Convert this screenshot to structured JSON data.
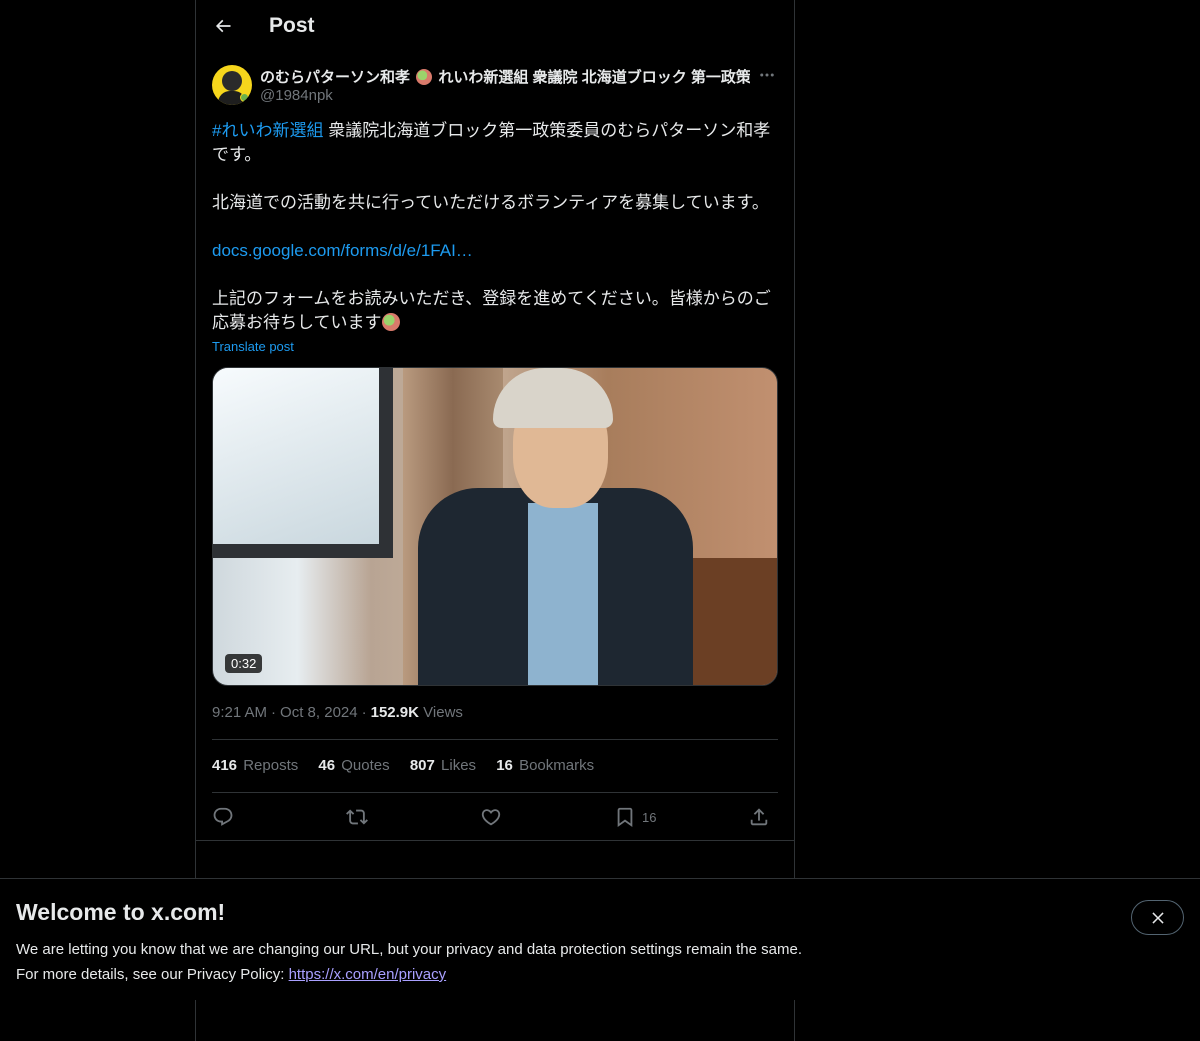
{
  "header": {
    "title": "Post",
    "back_icon": "arrow-left-icon"
  },
  "author": {
    "display_name_part1": "のむらパターソン和孝",
    "display_name_part2": "れいわ新選組 衆議院 北海道ブロック 第一政策委員",
    "handle": "@1984npk"
  },
  "tweet": {
    "hashtag": "#れいわ新選組",
    "line1_rest": " 衆議院北海道ブロック第一政策委員のむらパターソン和孝です。",
    "line2": "北海道での活動を共に行っていただけるボランティアを募集しています。",
    "link": "docs.google.com/forms/d/e/1FAI…",
    "line3": "上記のフォームをお読みいただき、登録を進めてください。皆様からのご応募お待ちしています",
    "translate_label": "Translate post"
  },
  "media": {
    "duration": "0:32"
  },
  "meta": {
    "time": "9:21 AM",
    "date": "Oct 8, 2024",
    "views_count": "152.9K",
    "views_label": "Views"
  },
  "stats": {
    "reposts_count": "416",
    "reposts_label": "Reposts",
    "quotes_count": "46",
    "quotes_label": "Quotes",
    "likes_count": "807",
    "likes_label": "Likes",
    "bookmarks_count": "16",
    "bookmarks_label": "Bookmarks"
  },
  "actions": {
    "reply_icon": "reply-icon",
    "repost_icon": "repost-icon",
    "like_icon": "heart-icon",
    "bookmark_icon": "bookmark-icon",
    "bookmark_count": "16",
    "share_icon": "share-icon"
  },
  "banner": {
    "title": "Welcome to x.com!",
    "line1": "We are letting you know that we are changing our URL, but your privacy and data protection settings remain the same.",
    "line2_prefix": "For more details, see our Privacy Policy: ",
    "link": "https://x.com/en/privacy"
  },
  "colors": {
    "background": "#000000",
    "text": "#e7e9ea",
    "muted": "#71767b",
    "accent": "#1d9bf0",
    "border": "#2f3336"
  }
}
